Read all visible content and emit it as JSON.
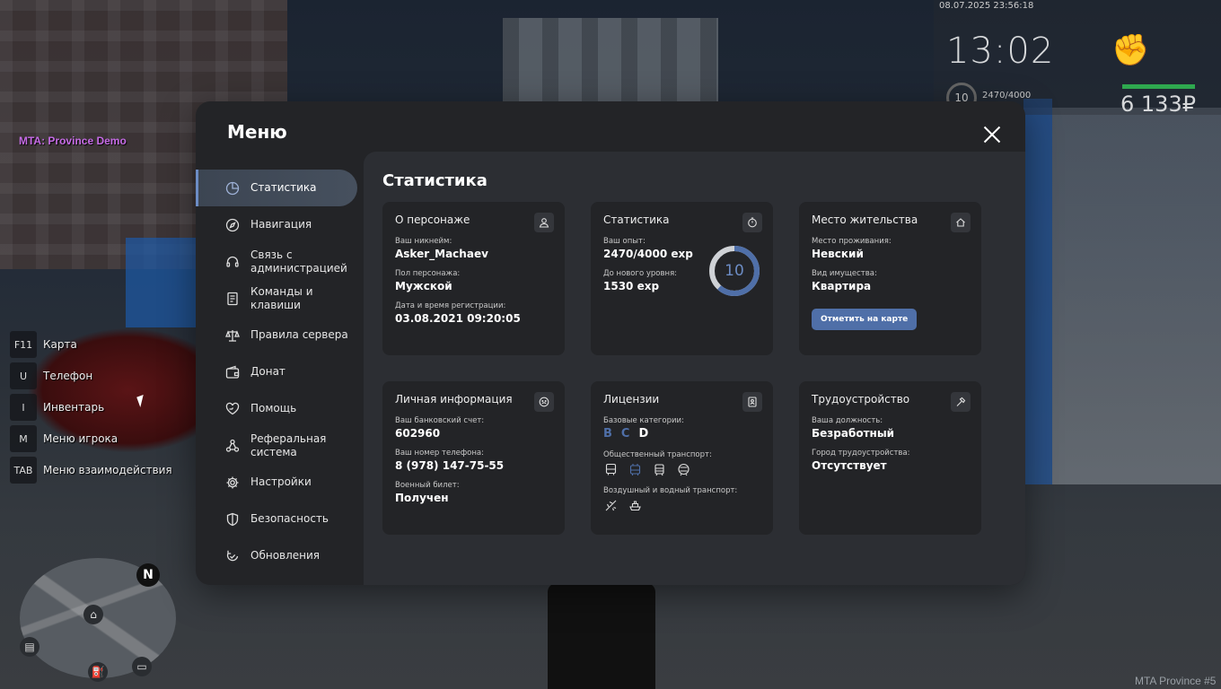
{
  "hud": {
    "server_label": "MTA: Province Demo",
    "date": "08.07.2025 23:56:18",
    "time": "13:02",
    "level": "10",
    "exp": "2470/4000",
    "health_fraction": 0.97,
    "money": "6 133₽",
    "watermark": "MTA Province #5",
    "hotkeys": [
      {
        "key": "F11",
        "label": "Карта"
      },
      {
        "key": "U",
        "label": "Телефон"
      },
      {
        "key": "I",
        "label": "Инвентарь"
      },
      {
        "key": "M",
        "label": "Меню игрока"
      },
      {
        "key": "TAB",
        "label": "Меню взаимодействия"
      }
    ],
    "minimap_north": "N"
  },
  "menu": {
    "title": "Меню",
    "nav": [
      {
        "label": "Статистика",
        "icon": "pie-chart-icon"
      },
      {
        "label": "Навигация",
        "icon": "compass-icon"
      },
      {
        "label": "Связь с администрацией",
        "icon": "headset-icon"
      },
      {
        "label": "Команды и клавиши",
        "icon": "document-icon"
      },
      {
        "label": "Правила сервера",
        "icon": "scales-icon"
      },
      {
        "label": "Донат",
        "icon": "wallet-icon"
      },
      {
        "label": "Помощь",
        "icon": "heart-hand-icon"
      },
      {
        "label": "Реферальная система",
        "icon": "network-icon"
      },
      {
        "label": "Настройки",
        "icon": "gear-icon"
      },
      {
        "label": "Безопасность",
        "icon": "shield-icon"
      },
      {
        "label": "Обновления",
        "icon": "refresh-check-icon"
      }
    ],
    "accent_color": "#6c8cc4"
  },
  "content": {
    "title": "Статистика",
    "character": {
      "title": "О персонаже",
      "nickname_label": "Ваш никнейм:",
      "nickname": "Asker_Machaev",
      "gender_label": "Пол персонажа:",
      "gender": "Мужской",
      "reg_label": "Дата и время регистрации:",
      "reg": "03.08.2021 09:20:05"
    },
    "stats": {
      "title": "Статистика",
      "exp_label": "Ваш опыт:",
      "exp": "2470/4000 exp",
      "next_label": "До нового уровня:",
      "next": "1530 exp",
      "level": "10",
      "progress": 0.6175
    },
    "residence": {
      "title": "Место жительства",
      "place_label": "Место проживания:",
      "place": "Невский",
      "property_label": "Вид имущества:",
      "property": "Квартира",
      "map_button": "Отметить на карте"
    },
    "personal": {
      "title": "Личная информация",
      "bank_label": "Ваш банковский счет:",
      "bank": "602960",
      "phone_label": "Ваш номер телефона:",
      "phone": "8 (978) 147-75-55",
      "military_label": "Военный билет:",
      "military": "Получен"
    },
    "licenses": {
      "title": "Лицензии",
      "base_label": "Базовые категории:",
      "categories": [
        {
          "name": "B",
          "color": "#4f6fa8"
        },
        {
          "name": "C",
          "color": "#4f6fa8"
        },
        {
          "name": "D",
          "color": "#ffffff"
        }
      ],
      "public_label": "Общественный транспорт:",
      "air_label": "Воздушный и водный транспорт:"
    },
    "employment": {
      "title": "Трудоустройство",
      "position_label": "Ваша должность:",
      "position": "Безработный",
      "city_label": "Город трудоустройства:",
      "city": "Отсутствует"
    }
  }
}
